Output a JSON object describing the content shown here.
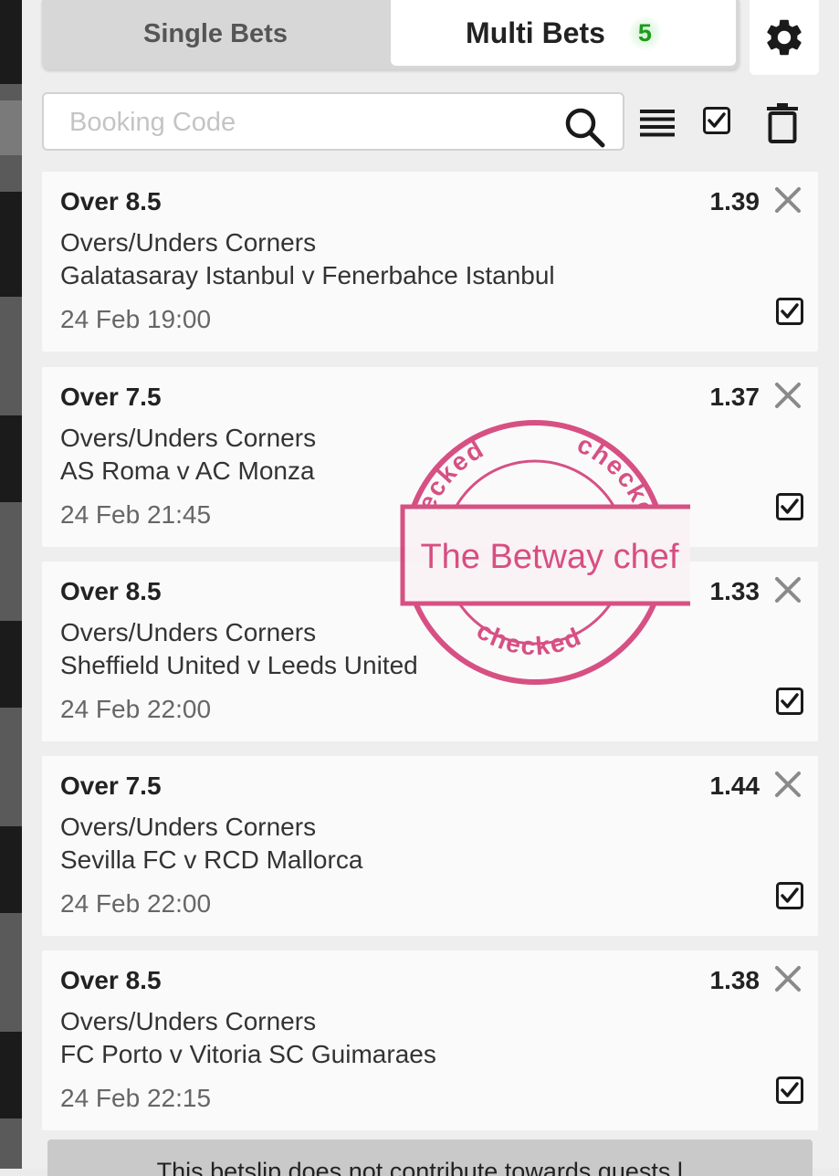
{
  "tabs": {
    "single_label": "Single Bets",
    "multi_label": "Multi Bets",
    "multi_count": "5"
  },
  "search": {
    "placeholder": "Booking Code",
    "value": ""
  },
  "bets": [
    {
      "selection": "Over 8.5",
      "odds": "1.39",
      "market": "Overs/Unders Corners",
      "event": "Galatasaray Istanbul v Fenerbahce Istanbul",
      "time": "24 Feb 19:00",
      "checked": true
    },
    {
      "selection": "Over 7.5",
      "odds": "1.37",
      "market": "Overs/Unders Corners",
      "event": "AS Roma v AC Monza",
      "time": "24 Feb 21:45",
      "checked": true
    },
    {
      "selection": "Over 8.5",
      "odds": "1.33",
      "market": "Overs/Unders Corners",
      "event": "Sheffield United v Leeds United",
      "time": "24 Feb 22:00",
      "checked": true
    },
    {
      "selection": "Over 7.5",
      "odds": "1.44",
      "market": "Overs/Unders Corners",
      "event": "Sevilla FC v RCD Mallorca",
      "time": "24 Feb 22:00",
      "checked": true
    },
    {
      "selection": "Over 8.5",
      "odds": "1.38",
      "market": "Overs/Unders Corners",
      "event": "FC Porto v Vitoria SC Guimaraes",
      "time": "24 Feb 22:15",
      "checked": true
    }
  ],
  "stamp": {
    "text": "The Betway chef",
    "ring_word": "checked"
  },
  "notice": {
    "text": "This betslip does not contribute towards quests l..."
  },
  "colors": {
    "count_green": "#1c9a1c",
    "stamp_pink": "#d1336f"
  }
}
